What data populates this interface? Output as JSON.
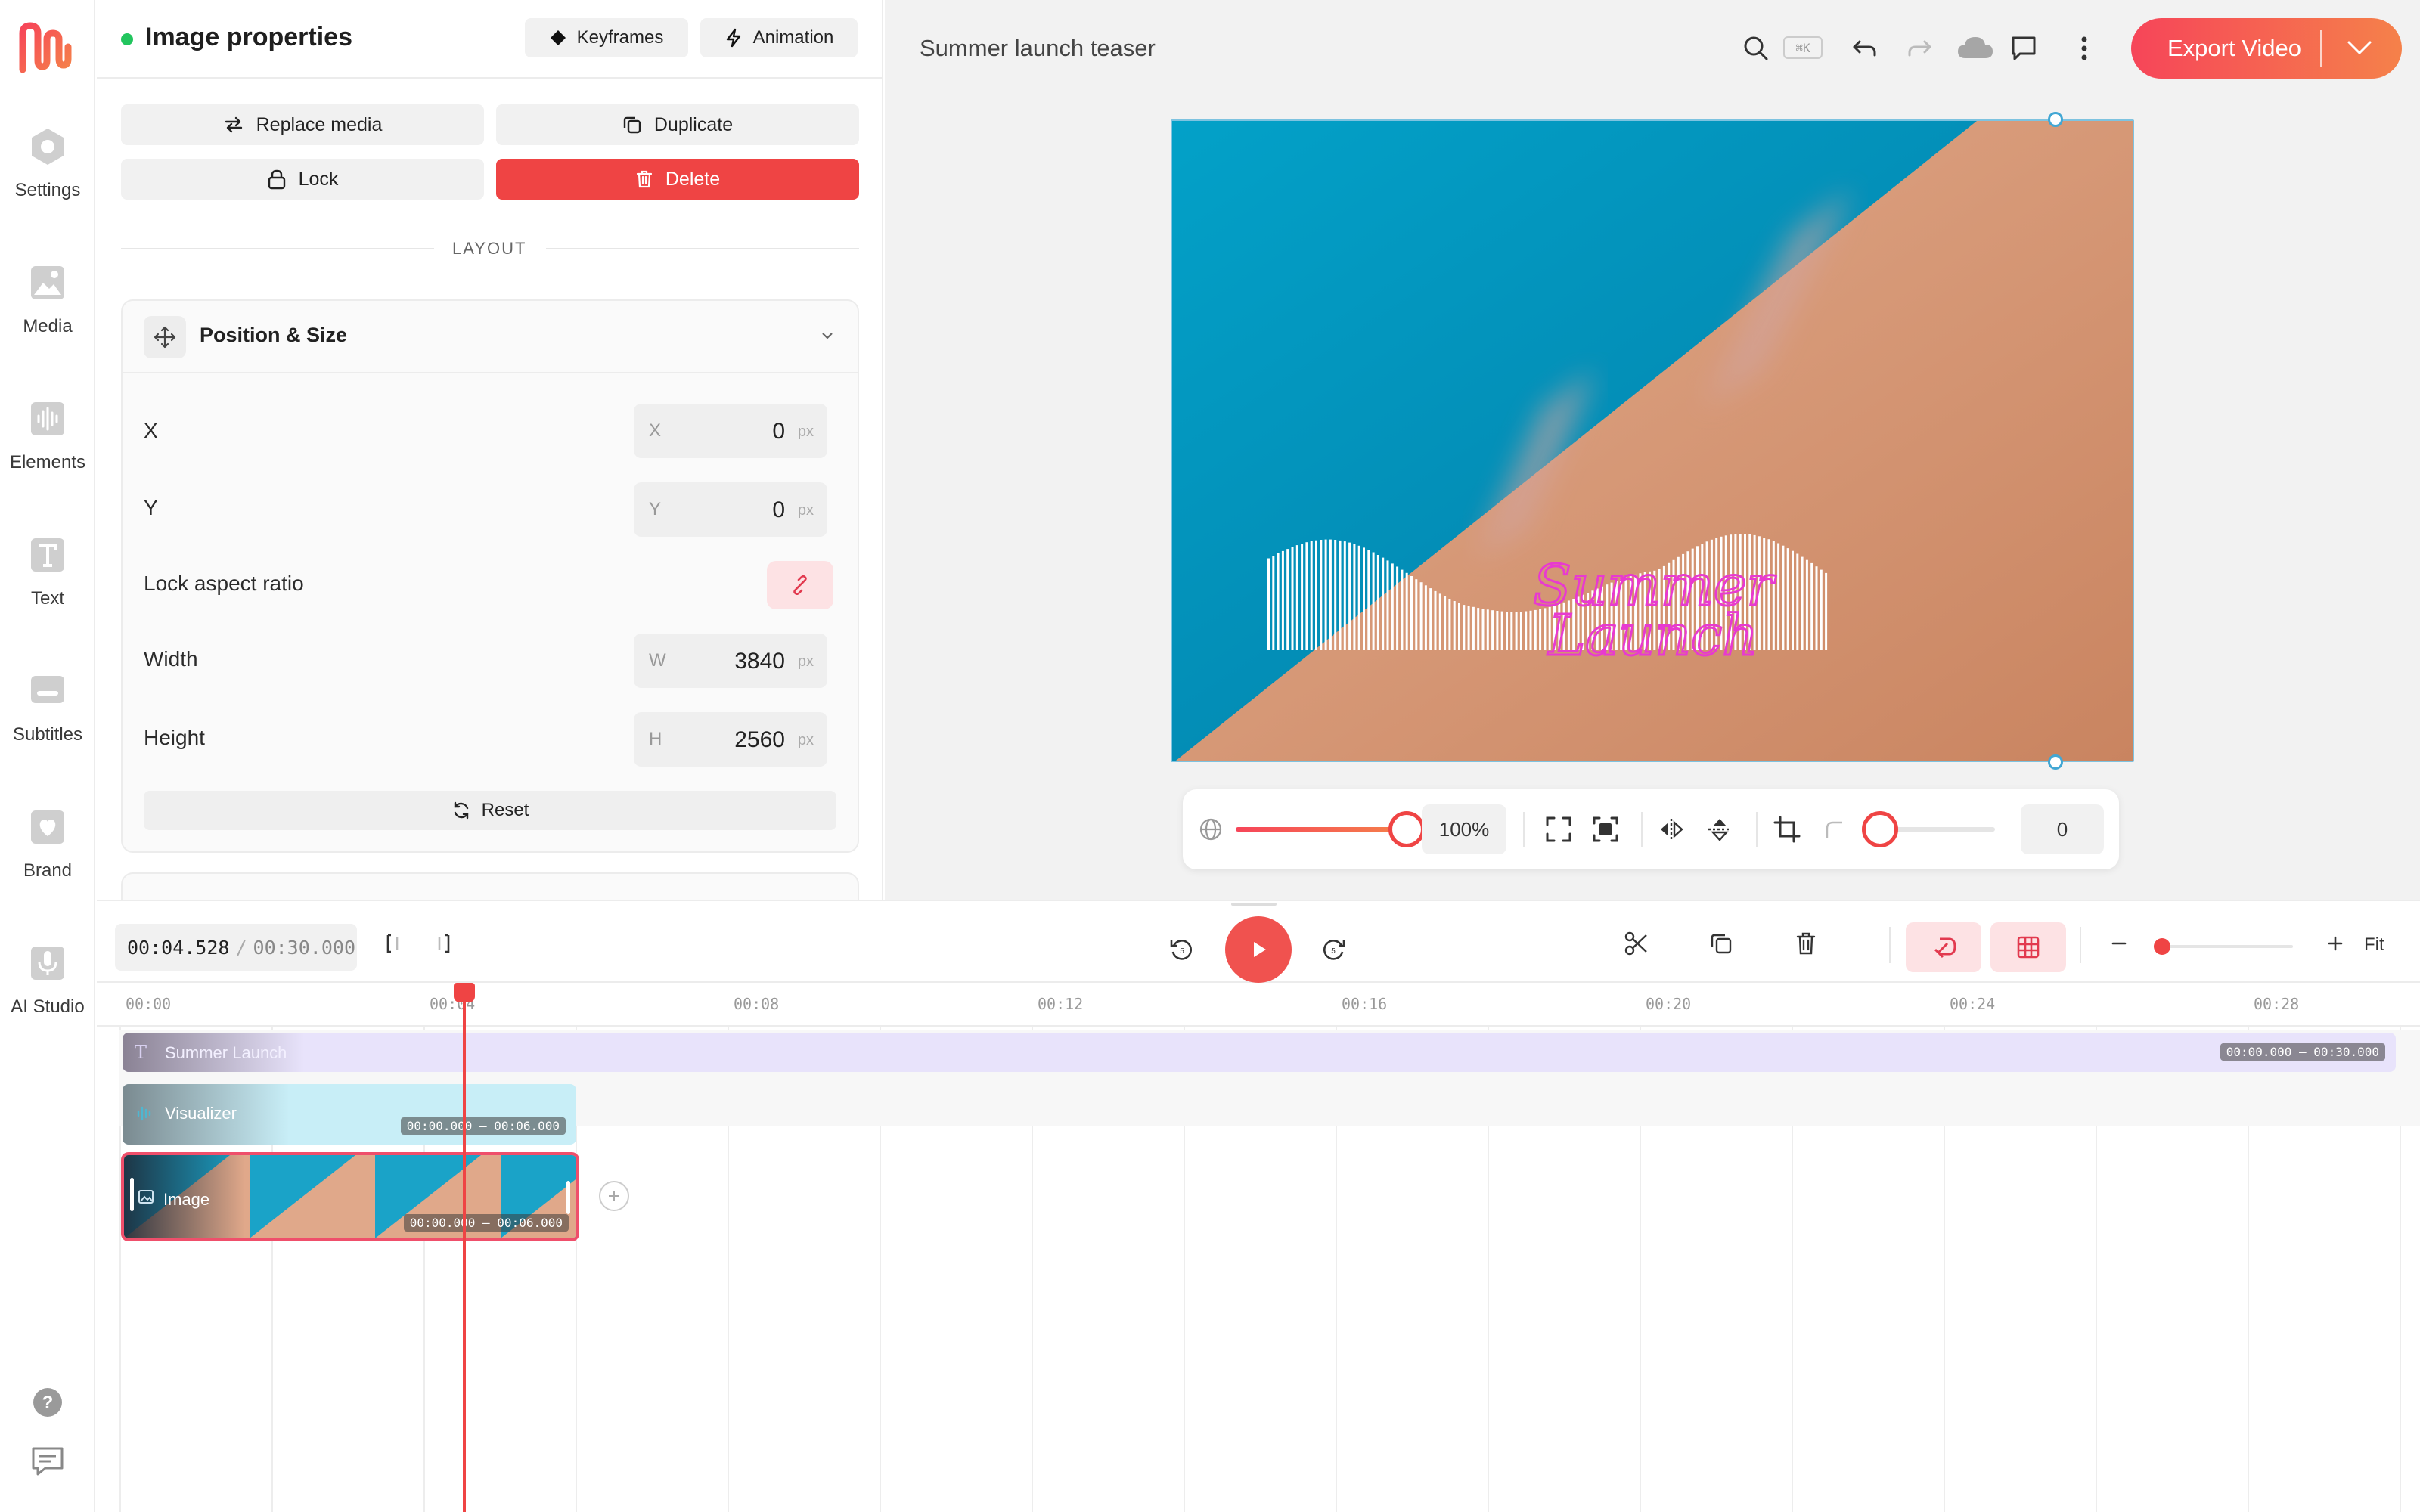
{
  "sidebar": {
    "items": [
      {
        "label": "Settings",
        "icon": "settings-icon"
      },
      {
        "label": "Media",
        "icon": "media-icon"
      },
      {
        "label": "Elements",
        "icon": "elements-icon"
      },
      {
        "label": "Text",
        "icon": "text-icon"
      },
      {
        "label": "Subtitles",
        "icon": "subtitles-icon"
      },
      {
        "label": "Brand",
        "icon": "brand-icon"
      },
      {
        "label": "AI Studio",
        "icon": "microphone-icon"
      }
    ]
  },
  "panel": {
    "title": "Image properties",
    "keyframes_label": "Keyframes",
    "animation_label": "Animation",
    "replace_label": "Replace media",
    "duplicate_label": "Duplicate",
    "lock_label": "Lock",
    "delete_label": "Delete",
    "section_label": "LAYOUT",
    "position_size": {
      "title": "Position & Size",
      "x": {
        "label": "X",
        "prefix": "X",
        "value": "0",
        "unit": "px"
      },
      "y": {
        "label": "Y",
        "prefix": "Y",
        "value": "0",
        "unit": "px"
      },
      "lock_aspect_label": "Lock aspect ratio",
      "width": {
        "label": "Width",
        "prefix": "W",
        "value": "3840",
        "unit": "px"
      },
      "height": {
        "label": "Height",
        "prefix": "H",
        "value": "2560",
        "unit": "px"
      },
      "reset_label": "Reset"
    }
  },
  "topbar": {
    "project_title": "Summer launch teaser",
    "shortcut": "⌘K",
    "export_label": "Export Video"
  },
  "canvas": {
    "overlay_text_line1": "Summer",
    "overlay_text_line2": "Launch",
    "zoom_value": "100%",
    "rotation_value": "0",
    "zoom_level": 1.0
  },
  "timeline": {
    "current_time": "00:04.528",
    "separator": "/",
    "total_time": "00:30.000",
    "fit_label": "Fit",
    "ticks": [
      "00:00",
      "00:04",
      "00:08",
      "00:12",
      "00:16",
      "00:20",
      "00:24",
      "00:28"
    ],
    "tracks": [
      {
        "name": "Summer Launch",
        "range": "00:00.000 – 00:30.000"
      },
      {
        "name": "Visualizer",
        "range": "00:00.000 – 00:06.000"
      },
      {
        "name": "Image",
        "range": "00:00.000 – 00:06.000"
      }
    ]
  },
  "colors": {
    "accent": "#ef4444",
    "brand_gradient_start": "#f64559",
    "brand_gradient_end": "#f5814a",
    "selection_handle": "#42a7d4",
    "text_track": "#e8e3fb",
    "visualizer_track": "#c8eef7"
  }
}
